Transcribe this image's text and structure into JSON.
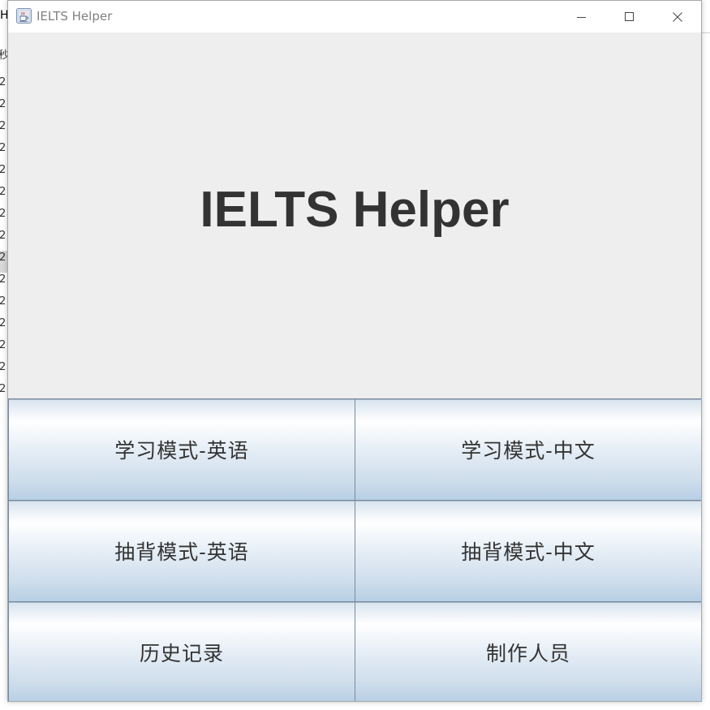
{
  "background": {
    "title_fragment": "H",
    "row_fragments": [
      "2",
      "2",
      "2",
      "2",
      "2",
      "2",
      "2",
      "2",
      "2",
      "2",
      "2",
      "2",
      "2",
      "2",
      "2"
    ],
    "cut_char": "秒"
  },
  "window": {
    "title": "IELTS Helper",
    "icon": "java-cup-icon",
    "controls": {
      "minimize": "minimize-icon",
      "maximize": "maximize-icon",
      "close": "close-icon"
    }
  },
  "main": {
    "headline": "IELTS Helper"
  },
  "buttons": {
    "study_english": "学习模式-英语",
    "study_chinese": "学习模式-中文",
    "recite_english": "抽背模式-英语",
    "recite_chinese": "抽背模式-中文",
    "history": "历史记录",
    "credits": "制作人员"
  },
  "colors": {
    "content_bg": "#eeeeee",
    "headline": "#333333",
    "button_border": "#7a8a9c",
    "button_gradient_bottom": "#b8cfe4"
  }
}
